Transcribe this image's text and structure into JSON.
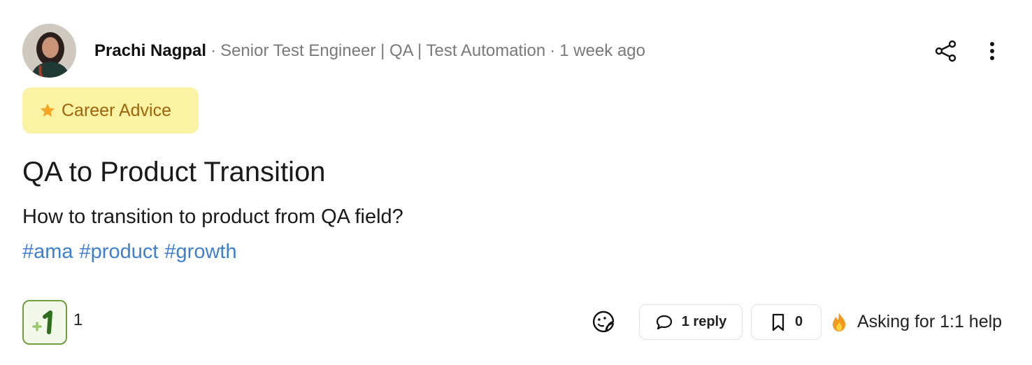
{
  "post": {
    "author_name": "Prachi Nagpal",
    "separator": "·",
    "author_headline": "Senior Test Engineer | QA | Test Automation",
    "time_ago": "1 week ago",
    "category": "Career Advice",
    "title": "QA to Product Transition",
    "body": "How to transition to product from QA field?",
    "hashtags": [
      "#ama",
      "#product",
      "#growth"
    ]
  },
  "actions": {
    "plusone_count": "1",
    "reply_label": "1 reply",
    "bookmark_count": "0",
    "asking_label": "Asking for 1:1 help"
  },
  "icons": {
    "share": "share-icon",
    "more": "more-vertical-icon",
    "star": "star-icon",
    "plusone": "plus-one-icon",
    "emoji": "emoji-sticker-icon",
    "comment": "comment-icon",
    "bookmark": "bookmark-icon",
    "fire": "fire-icon"
  },
  "colors": {
    "category_bg": "#faf3a3",
    "category_text": "#a0650c",
    "hashtag": "#3f7fd0",
    "plusone_border": "#6ea03e",
    "muted_text": "#7a7a7a"
  }
}
